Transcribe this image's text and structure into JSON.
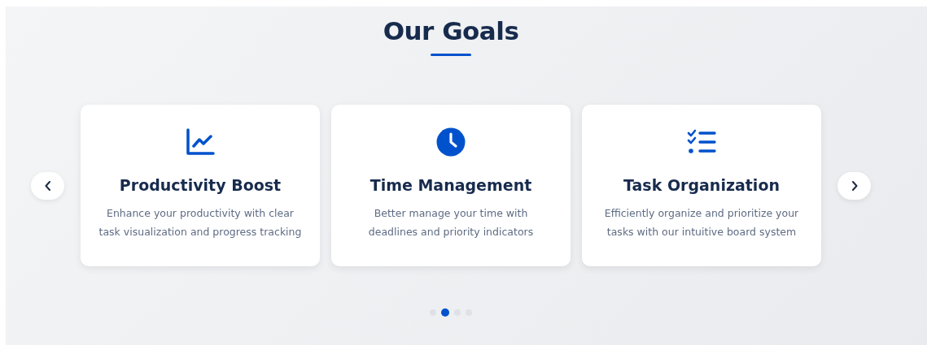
{
  "section": {
    "title": "Our Goals"
  },
  "cards": [
    {
      "kind": "chart",
      "title": "Productivity Boost",
      "description": "Enhance your productivity with clear task visualization and progress tracking"
    },
    {
      "kind": "clock",
      "title": "Time Management",
      "description": "Better manage your time with deadlines and priority indicators"
    },
    {
      "kind": "checklist",
      "title": "Task Organization",
      "description": "Efficiently organize and prioritize your tasks with our intuitive board system"
    }
  ],
  "dots": [
    {
      "selected": false
    },
    {
      "selected": true
    },
    {
      "selected": false
    },
    {
      "selected": false
    }
  ]
}
